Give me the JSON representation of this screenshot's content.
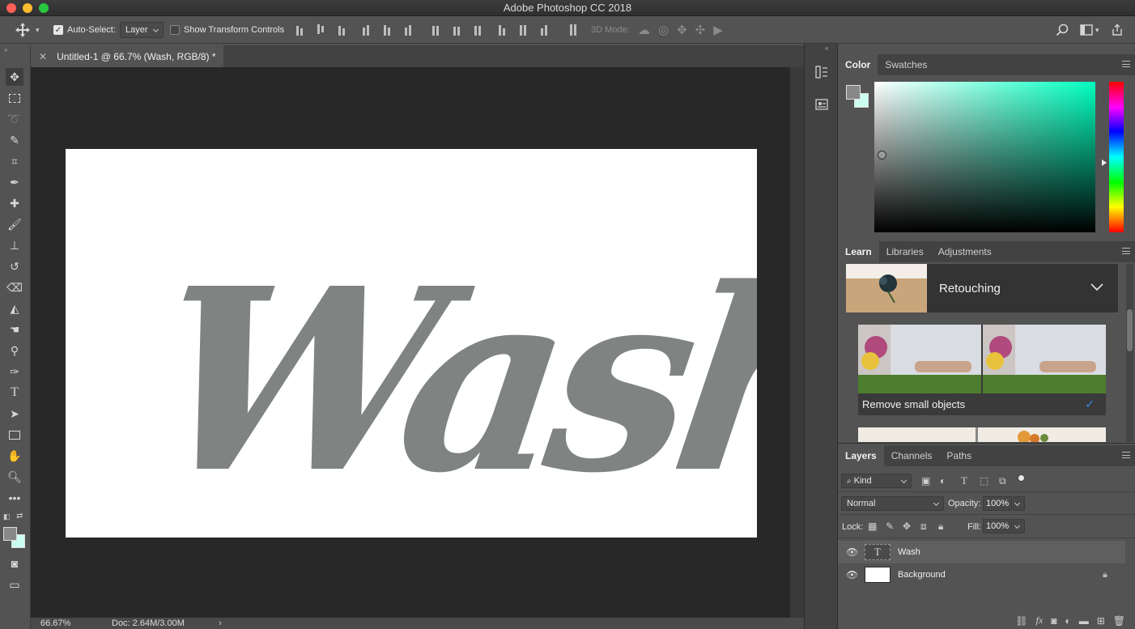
{
  "app": {
    "title": "Adobe Photoshop CC 2018"
  },
  "options_bar": {
    "move_tool_icon": "move-icon",
    "auto_select_label": "Auto-Select:",
    "auto_select_checked": true,
    "auto_select_value": "Layer",
    "show_transform_label": "Show Transform Controls",
    "show_transform_checked": false,
    "three_d_mode_label": "3D Mode:"
  },
  "document": {
    "tab_label": "Untitled-1 @ 66.7% (Wash, RGB/8) *",
    "canvas_text": "Wash",
    "canvas_text_color": "#7f8382",
    "canvas_bg": "#ffffff"
  },
  "status": {
    "zoom": "66.67%",
    "doc_size": "Doc: 2.64M/3.00M"
  },
  "color_panel": {
    "tabs": [
      "Color",
      "Swatches"
    ],
    "active_tab": "Color",
    "foreground": "#888888",
    "background": "#ccfff2"
  },
  "learn_panel": {
    "tabs": [
      "Learn",
      "Libraries",
      "Adjustments"
    ],
    "active_tab": "Learn",
    "section_title": "Retouching",
    "item_label": "Remove small objects",
    "item_done": true
  },
  "layers_panel": {
    "tabs": [
      "Layers",
      "Channels",
      "Paths"
    ],
    "active_tab": "Layers",
    "filter_kind": "Kind",
    "blend_mode": "Normal",
    "opacity_label": "Opacity:",
    "opacity_value": "100%",
    "lock_label": "Lock:",
    "fill_label": "Fill:",
    "fill_value": "100%",
    "layers": [
      {
        "name": "Wash",
        "type": "text",
        "selected": true,
        "locked": false
      },
      {
        "name": "Background",
        "type": "raster",
        "selected": false,
        "locked": true
      }
    ]
  },
  "colors": {
    "accent_blue": "#2d8ceb",
    "panel_bg": "#535353",
    "canvas_area": "#282828"
  }
}
